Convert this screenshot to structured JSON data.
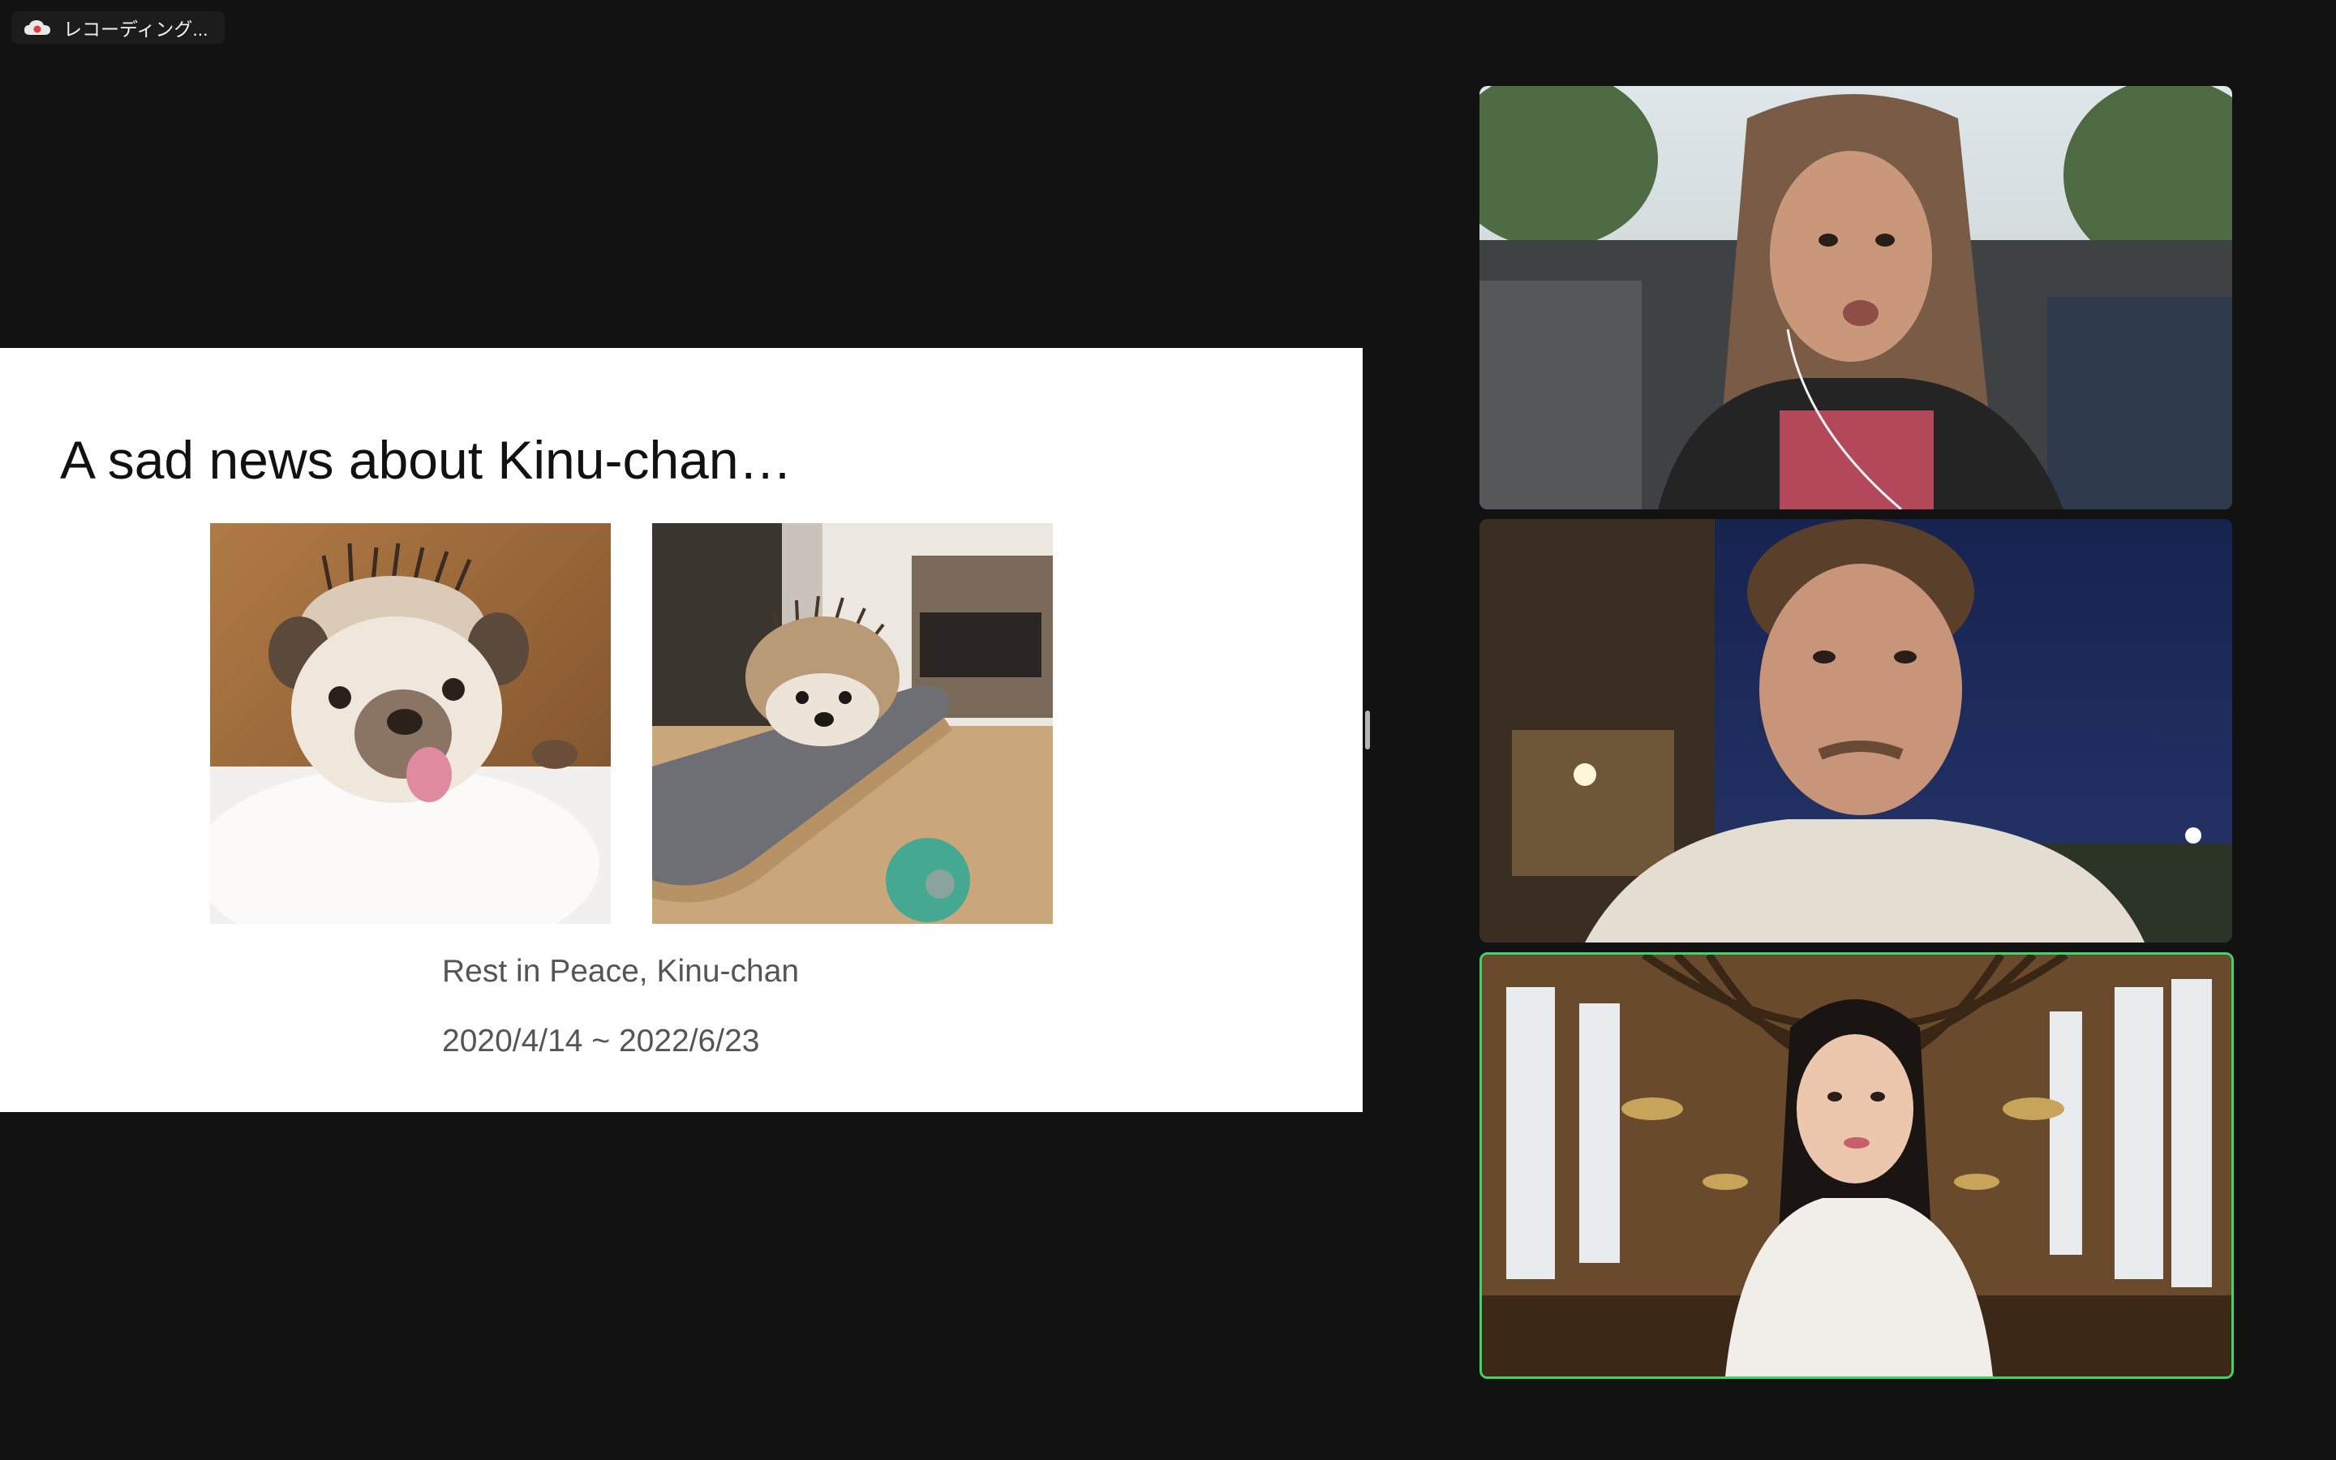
{
  "recording": {
    "label": "レコーディング...",
    "icon": "cloud-record-icon"
  },
  "slide": {
    "title": "A sad news about Kinu-chan…",
    "caption": "Rest in Peace, Kinu-chan",
    "dates": "2020/4/14 ~ 2022/6/23"
  },
  "participants": [
    {
      "tile": "participant-video-1",
      "active_speaker": false
    },
    {
      "tile": "participant-video-2",
      "active_speaker": false
    },
    {
      "tile": "participant-video-3",
      "active_speaker": true
    }
  ],
  "colors": {
    "background": "#121212",
    "active_speaker_border": "#3fd46a",
    "recording_dot": "#e0403a"
  }
}
